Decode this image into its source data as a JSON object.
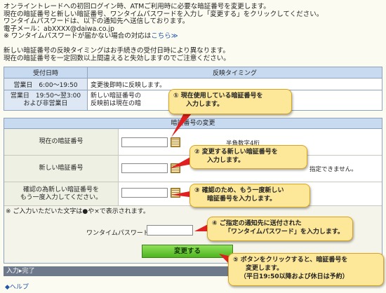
{
  "intro": {
    "line1": "オンライントレードへの初回ログイン時、ATMご利用時に必要な暗証番号を変更します。",
    "line2": "現在の暗証番号と新しい暗証番号、ワンタイムパスワードを入力し「変更する」をクリックしてください。",
    "line3": "ワンタイムパスワードは、以下の通知先へ送信しております。",
    "line4": "電子メール：abXXXX@daiwa.co.jp",
    "line5_prefix": "※ ワンタイムパスワードが届かない場合の対応は",
    "line5_link": "こちら≫"
  },
  "notice": {
    "line1": "新しい暗証番号の反映タイミングはお手続きの受付日時により異なります。",
    "line2": "現在の暗証番号を一定回数以上間違えると失効しますのでご注意ください。"
  },
  "timing_table": {
    "headers": [
      "受付日時",
      "反映タイミング"
    ],
    "rows": [
      {
        "when": "営業日　6:00～19:50",
        "timing": "変更後即時に反映します。"
      },
      {
        "when1": "営業日　19:50～翌3:00",
        "when2": "および非営業日",
        "timing1": "新しい暗証番号の",
        "timing2": "反映前は現在の暗"
      }
    ]
  },
  "change_form": {
    "title": "暗証番号の変更",
    "current_label": "現在の暗証番号",
    "current_hint": "半角数字4桁",
    "new_label": "新しい暗証番号",
    "new_hint": "指定できません。",
    "confirm_label1": "確認の為新しい暗証番号を",
    "confirm_label2": "もう一度入力してください。",
    "masked_note": "※ ご入力いただいた文字は●や×で表示されます。",
    "otp_label": "ワンタイムパスワード",
    "submit_label": "変更する"
  },
  "progress": {
    "step_input": "入力",
    "separator": "▸",
    "step_done": "完了"
  },
  "help_link": "◆ヘルプ",
  "callouts": {
    "c1_l1": "① 現在使用している暗証番号を",
    "c1_l2": "入力します。",
    "c2_l1": "② 変更する新しい暗証番号を",
    "c2_l2": "入力します。",
    "c3_l1": "③ 確認のため、もう一度新しい",
    "c3_l2": "暗証番号を入力します。",
    "c4_l1": "④ ご指定の通知先に送付された",
    "c4_l2": "「ワンタイムパスワード」を入力します。",
    "c5_l1": "⑤ ボタンをクリックすると、暗証番号を",
    "c5_l2": "変更します。",
    "c5_l3": "（平日19:50以降および休日は予約）"
  },
  "colors": {
    "accent_red": "#e02020",
    "callout_fill": "#fde89a",
    "submit_green": "#4fb420"
  },
  "icons": {
    "keypad": "software-keyboard-icon",
    "arrow": "callout-arrow"
  }
}
